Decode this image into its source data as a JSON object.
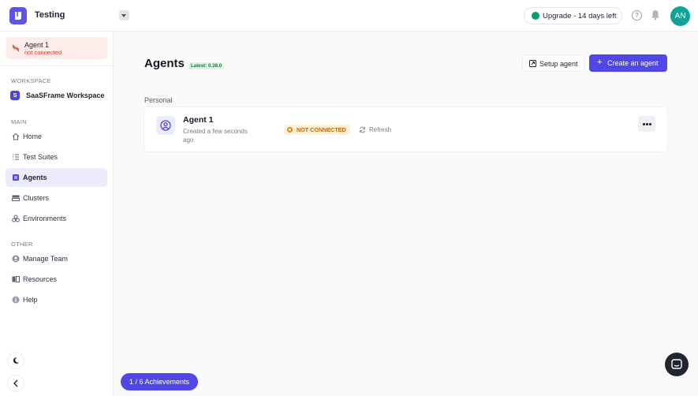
{
  "header": {
    "app_title": "Testing",
    "upgrade_label": "Upgrade - 14 days left",
    "help_glyph": "?",
    "avatar_initials": "AN",
    "icons": {
      "logo": "app-logo-icon",
      "dropdown": "chevron-down-icon",
      "help": "help-icon",
      "notifications": "bell-icon"
    }
  },
  "sidebar": {
    "agent_status": {
      "name": "Agent 1",
      "status": "not connected",
      "icon": "disconnected-icon"
    },
    "workspace_label": "WORKSPACE",
    "workspace_badge": "S",
    "workspace_name": "SaaSFrame Workspace",
    "main_label": "MAIN",
    "main_items": [
      {
        "label": "Home",
        "icon": "home-icon",
        "active": false
      },
      {
        "label": "Test Suites",
        "icon": "list-icon",
        "active": false
      },
      {
        "label": "Agents",
        "icon": "agent-icon",
        "active": true
      },
      {
        "label": "Clusters",
        "icon": "server-icon",
        "active": false
      },
      {
        "label": "Environments",
        "icon": "cubes-icon",
        "active": false
      }
    ],
    "other_label": "OTHER",
    "other_items": [
      {
        "label": "Manage Team",
        "icon": "team-icon"
      },
      {
        "label": "Resources",
        "icon": "book-icon"
      },
      {
        "label": "Help",
        "icon": "info-icon"
      }
    ],
    "theme_toggle_icon": "moon-icon",
    "collapse_icon": "chevron-left-icon"
  },
  "main": {
    "title": "Agents",
    "version_badge": "Latest: 0.38.0",
    "setup_button": "Setup agent",
    "create_button": "Create an agent",
    "create_plus": "+",
    "group_label": "Personal",
    "agents": [
      {
        "name": "Agent 1",
        "created": "Created a few seconds ago",
        "status": "NOT CONNECTED",
        "refresh_label": "Refresh",
        "icon": "user-circle-icon"
      }
    ]
  },
  "footer": {
    "achievements": "1 / 6 Achievements",
    "chat_icon": "chat-icon"
  },
  "colors": {
    "accent": "#5147e6",
    "success": "#0a9b6e",
    "warning": "#e08712",
    "danger": "#d33a2c"
  }
}
